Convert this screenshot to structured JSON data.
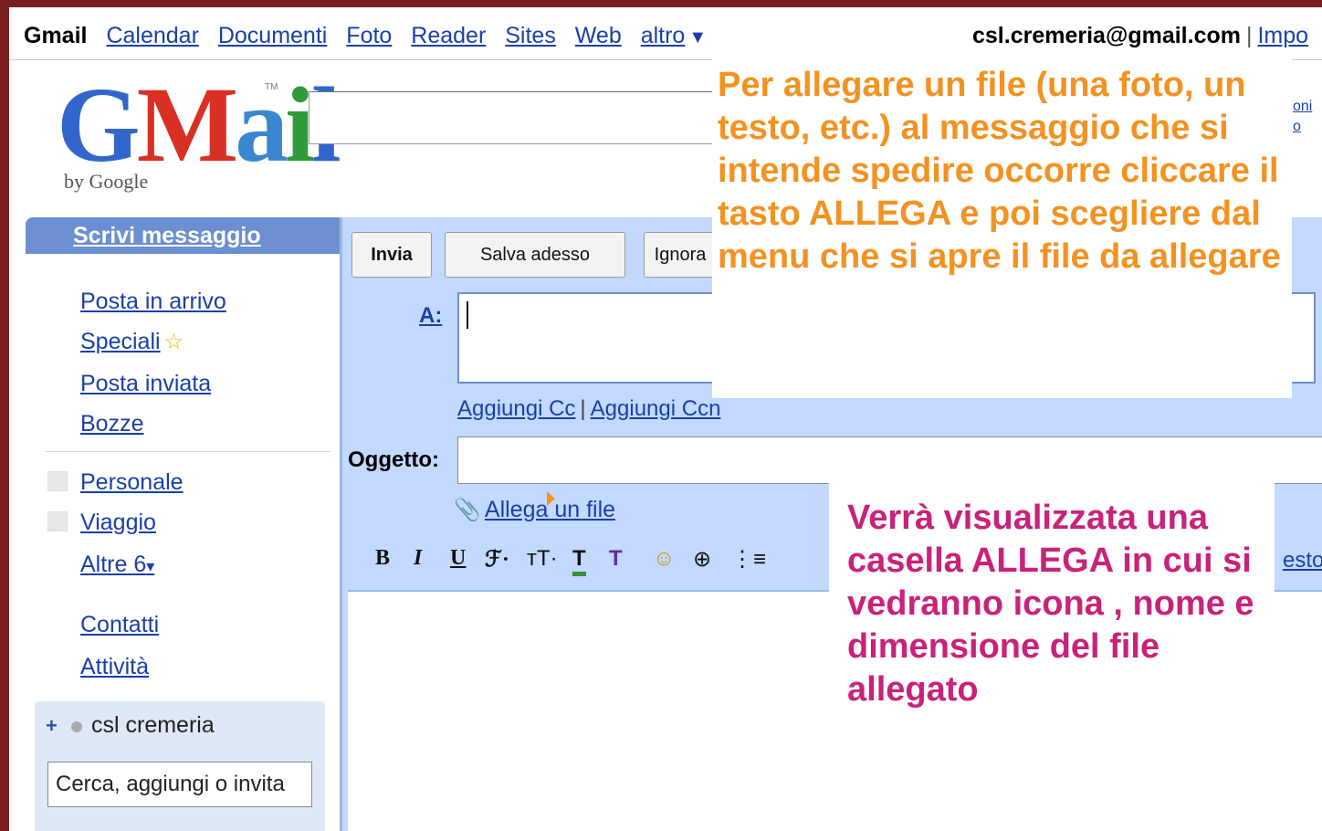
{
  "topbar": {
    "brand": "Gmail",
    "links": [
      "Calendar",
      "Documenti",
      "Foto",
      "Reader",
      "Sites",
      "Web"
    ],
    "more": "altro",
    "account": "csl.cremeria@gmail.com",
    "separator": "|",
    "settings_link": "Impo"
  },
  "logo": {
    "word_g": "G",
    "word_m": "M",
    "word_a": "a",
    "word_i": "i",
    "word_l": "l",
    "tm": "TM",
    "by": "by Google"
  },
  "right_links": [
    "oni",
    "o"
  ],
  "sidebar": {
    "compose_label": "Scrivi messaggio",
    "items": [
      "Posta in arrivo",
      "Speciali",
      "Posta inviata",
      "Bozze"
    ],
    "labels": [
      "Personale",
      "Viaggio"
    ],
    "more_labels": "Altre 6",
    "contacts": "Contatti",
    "tasks": "Attività",
    "chat_name": "csl cremeria",
    "chat_search": "Cerca, aggiungi o invita"
  },
  "compose": {
    "send": "Invia",
    "save": "Salva adesso",
    "discard": "Ignora",
    "to_label": "A:",
    "add_cc": "Aggiungi Cc",
    "add_bcc": "Aggiungi Ccn",
    "cc_sep": "|",
    "subject_label": "Oggetto:",
    "attach_link": "Allega un file",
    "plain_text_link": "esto",
    "toolbar": {
      "bold": "B",
      "italic": "I",
      "underline": "U",
      "font": "ℱ·",
      "size": "тT·",
      "color": "T",
      "highlight": "T",
      "smiley": "☺",
      "link": "⊕",
      "list": "⋮≡"
    }
  },
  "callouts": {
    "top": "Per allegare un file (una foto, un testo, etc.) al messaggio che si intende spedire occorre cliccare il tasto ALLEGA e poi scegliere dal menu che si apre il file da allegare",
    "bottom": "Verrà visualizzata una casella ALLEGA in cui si vedranno icona , nome e dimensione del file allegato"
  },
  "colors": {
    "callout_top": "#f39221",
    "callout_bottom": "#c8227a",
    "link": "#1a3fa8",
    "compose_bg": "#c3d9ff",
    "frame": "#7a1f1f"
  }
}
